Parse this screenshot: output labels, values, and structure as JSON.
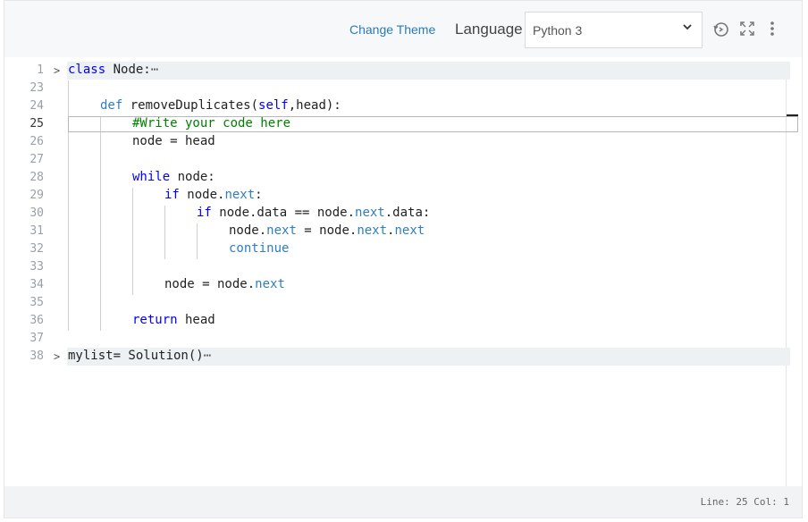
{
  "toolbar": {
    "change_theme": "Change Theme",
    "language_label": "Language",
    "language_value": "Python 3",
    "icons": [
      "history-icon",
      "fullscreen-icon",
      "more-vertical-icon"
    ]
  },
  "editor": {
    "lines": [
      {
        "num": "1",
        "text": "class Node:"
      },
      {
        "num": "23",
        "text": ""
      },
      {
        "num": "24",
        "text": "def removeDuplicates(self,head):"
      },
      {
        "num": "25",
        "text": "#Write your code here"
      },
      {
        "num": "26",
        "text": "node = head"
      },
      {
        "num": "27",
        "text": ""
      },
      {
        "num": "28",
        "text": "while node:"
      },
      {
        "num": "29",
        "text": "if node.next:"
      },
      {
        "num": "30",
        "text": "if node.data == node.next.data:"
      },
      {
        "num": "31",
        "text": "node.next = node.next.next"
      },
      {
        "num": "32",
        "text": "continue"
      },
      {
        "num": "33",
        "text": ""
      },
      {
        "num": "34",
        "text": "node = node.next"
      },
      {
        "num": "35",
        "text": ""
      },
      {
        "num": "36",
        "text": "return head"
      },
      {
        "num": "37",
        "text": ""
      },
      {
        "num": "38",
        "text": "mylist= Solution()"
      }
    ],
    "fold_marker": "⋯"
  },
  "status": {
    "text": "Line: 25 Col: 1"
  }
}
